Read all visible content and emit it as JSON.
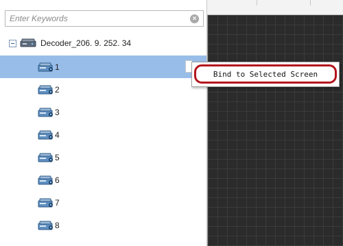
{
  "search": {
    "placeholder": "Enter Keywords",
    "value": ""
  },
  "tree": {
    "root": {
      "label": "Decoder_206. 9. 252. 34",
      "expanded": true,
      "icon": "decoder-device-icon"
    },
    "items": [
      {
        "label": "1",
        "selected": true,
        "icon": "output-port-icon"
      },
      {
        "label": "2",
        "selected": false,
        "icon": "output-port-icon"
      },
      {
        "label": "3",
        "selected": false,
        "icon": "output-port-icon"
      },
      {
        "label": "4",
        "selected": false,
        "icon": "output-port-icon"
      },
      {
        "label": "5",
        "selected": false,
        "icon": "output-port-icon"
      },
      {
        "label": "6",
        "selected": false,
        "icon": "output-port-icon"
      },
      {
        "label": "7",
        "selected": false,
        "icon": "output-port-icon"
      },
      {
        "label": "8",
        "selected": false,
        "icon": "output-port-icon"
      }
    ]
  },
  "context_menu": {
    "items": [
      {
        "label": "Bind to Selected Screen",
        "highlighted": true
      }
    ]
  },
  "colors": {
    "selection": "#99bde9",
    "grid_bg": "#2b2b2b",
    "highlight": "#b4141c"
  }
}
